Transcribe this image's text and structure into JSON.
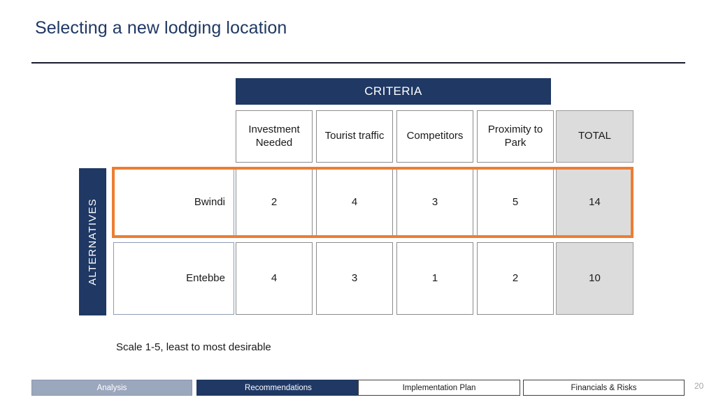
{
  "slide": {
    "title": "Selecting a new lodging location",
    "page_number": "20",
    "scale_note": "Scale 1-5, least to most desirable"
  },
  "matrix": {
    "criteria_banner": "CRITERIA",
    "alternatives_label": "ALTERNATIVES",
    "criteria_headers": [
      "Investment Needed",
      "Tourist traffic",
      "Competitors",
      "Proximity to Park"
    ],
    "total_header": "TOTAL",
    "rows": [
      {
        "name": "Bwindi",
        "scores": [
          "2",
          "4",
          "3",
          "5"
        ],
        "total": "14",
        "highlighted": true
      },
      {
        "name": "Entebbe",
        "scores": [
          "4",
          "3",
          "1",
          "2"
        ],
        "total": "10",
        "highlighted": false
      }
    ]
  },
  "footer": {
    "items": [
      {
        "label": "Analysis",
        "state": "past"
      },
      {
        "label": "Recommendations",
        "state": "current"
      },
      {
        "label": "Implementation Plan",
        "state": "future"
      },
      {
        "label": "Financials & Risks",
        "state": "future"
      }
    ]
  },
  "colors": {
    "navy": "#1F3864",
    "orange_highlight": "#ED7D31",
    "total_fill": "#DCDCDC",
    "past_nav": "#9BA7BC"
  }
}
